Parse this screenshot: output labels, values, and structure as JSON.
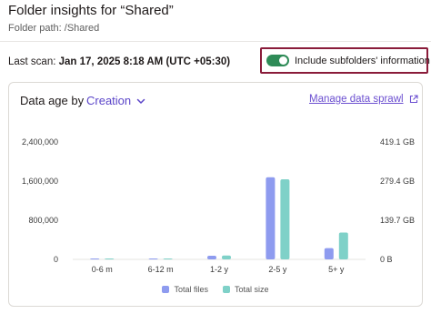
{
  "header": {
    "title": "Folder insights for “Shared”",
    "folder_path": "Folder path: /Shared"
  },
  "scan": {
    "label": "Last scan: ",
    "value": "Jan 17, 2025 8:18 AM (UTC +05:30)"
  },
  "include_subfolders": {
    "label": "Include subfolders' information",
    "checked": true
  },
  "card": {
    "data_age_label": "Data age by",
    "selected_option": "Creation",
    "manage_link": "Manage data sprawl"
  },
  "colors": {
    "files": "#8e9bef",
    "size": "#7fd1c8",
    "accent": "#5b45c9",
    "highlight_border": "#8a1c3a",
    "toggle_on": "#2e8b57"
  },
  "icons": {
    "dropdown": "chevron-down-icon",
    "external": "external-link-icon"
  },
  "chart_data": {
    "type": "bar",
    "categories": [
      "0-6 m",
      "6-12 m",
      "1-2 y",
      "2-5 y",
      "5+ y"
    ],
    "series": [
      {
        "name": "Total files",
        "axis": "left",
        "values": [
          2000,
          8000,
          75000,
          1680000,
          230000
        ]
      },
      {
        "name": "Total size",
        "axis": "right",
        "values": [
          0.5,
          2,
          14,
          286,
          96
        ]
      }
    ],
    "left_axis": {
      "ticks": [
        "0",
        "800,000",
        "1,600,000",
        "2,400,000"
      ],
      "ylim": [
        0,
        2400000
      ]
    },
    "right_axis": {
      "ticks": [
        "0 B",
        "139.7 GB",
        "279.4 GB",
        "419.1 GB"
      ],
      "ylim_gb": [
        0,
        419.1
      ]
    },
    "grid": false,
    "legend": "bottom-center"
  }
}
